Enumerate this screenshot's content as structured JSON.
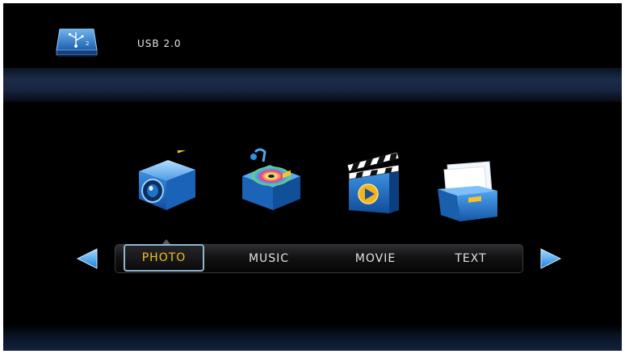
{
  "header": {
    "source_icon": "usb-drive-icon",
    "source_label": "USB  2.0"
  },
  "menu": {
    "selected_index": 0,
    "items": [
      {
        "label": "PHOTO",
        "icon": "camera-icon"
      },
      {
        "label": "MUSIC",
        "icon": "music-player-icon"
      },
      {
        "label": "MOVIE",
        "icon": "clapperboard-icon"
      },
      {
        "label": "TEXT",
        "icon": "document-folder-icon"
      }
    ]
  },
  "navigation": {
    "left_arrow": "arrow-left-icon",
    "right_arrow": "arrow-right-icon"
  },
  "colors": {
    "selected_text": "#f2c21b",
    "menu_text": "#e2e2e2",
    "accent_blue": "#2f8fe0",
    "background": "#000000"
  }
}
